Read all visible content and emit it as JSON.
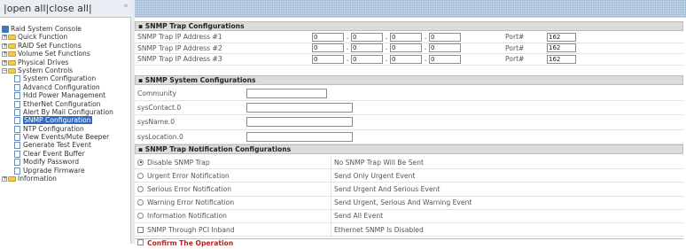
{
  "nav": {
    "open_all": "open all",
    "sep1": "|",
    "close_all": "close all",
    "sep2": "|",
    "root": "Raid System Console",
    "items": [
      {
        "label": "Quick Function",
        "type": "folder",
        "exp": "+"
      },
      {
        "label": "RAID Set Functions",
        "type": "folder",
        "exp": "+"
      },
      {
        "label": "Volume Set Functions",
        "type": "folder",
        "exp": "+"
      },
      {
        "label": "Physical Drives",
        "type": "folder",
        "exp": "+"
      },
      {
        "label": "System Controls",
        "type": "folder",
        "exp": "−"
      },
      {
        "label": "System Configuration",
        "type": "page"
      },
      {
        "label": "Advancd Configuration",
        "type": "page"
      },
      {
        "label": "Hdd Power Management",
        "type": "page"
      },
      {
        "label": "EtherNet Configuration",
        "type": "page"
      },
      {
        "label": "Alert By Mail Configuration",
        "type": "page"
      },
      {
        "label": "SNMP Configuration",
        "type": "page",
        "selected": true
      },
      {
        "label": "NTP Configuration",
        "type": "page"
      },
      {
        "label": "View Events/Mute Beeper",
        "type": "page"
      },
      {
        "label": "Generate Test Event",
        "type": "page"
      },
      {
        "label": "Clear Event Buffer",
        "type": "page"
      },
      {
        "label": "Modify Password",
        "type": "page"
      },
      {
        "label": "Upgrade Firmware",
        "type": "page"
      },
      {
        "label": "Information",
        "type": "folder",
        "exp": "+"
      }
    ]
  },
  "trap": {
    "header": "SNMP Trap Configurations",
    "rows": [
      {
        "label": "SNMP Trap IP Address #1",
        "ip": [
          "0",
          "0",
          "0",
          "0"
        ],
        "port_label": "Port#",
        "port": "162"
      },
      {
        "label": "SNMP Trap IP Address #2",
        "ip": [
          "0",
          "0",
          "0",
          "0"
        ],
        "port_label": "Port#",
        "port": "162"
      },
      {
        "label": "SNMP Trap IP Address #3",
        "ip": [
          "0",
          "0",
          "0",
          "0"
        ],
        "port_label": "Port#",
        "port": "162"
      }
    ]
  },
  "system": {
    "header": "SNMP System Configurations",
    "rows": [
      {
        "label": "Community",
        "value": ""
      },
      {
        "label": "sysContact.0",
        "value": ""
      },
      {
        "label": "sysName.0",
        "value": ""
      },
      {
        "label": "sysLocation.0",
        "value": ""
      }
    ]
  },
  "notify": {
    "header": "SNMP Trap Notification Configurations",
    "rows": [
      {
        "label": "Disable SNMP Trap",
        "desc": "No SNMP Trap Will Be Sent",
        "control": "radio",
        "checked": true
      },
      {
        "label": "Urgent Error Notification",
        "desc": "Send Only Urgent Event",
        "control": "radio",
        "checked": false
      },
      {
        "label": "Serious Error Notification",
        "desc": "Send Urgent And Serious Event",
        "control": "radio",
        "checked": false
      },
      {
        "label": "Warning Error Notification",
        "desc": "Send Urgent, Serious And Warning Event",
        "control": "radio",
        "checked": false
      },
      {
        "label": "Information Notification",
        "desc": "Send All Event",
        "control": "radio",
        "checked": false
      },
      {
        "label": "SNMP Through PCI Inband",
        "desc": "Ethernet SNMP Is Disabled",
        "control": "checkbox",
        "checked": false
      }
    ]
  },
  "confirm_label": "Confirm The Operation",
  "colors": {
    "top_bar": "#9eb8d4",
    "selected": "#316ac5",
    "section": "#dcdcdc",
    "confirm_text": "#b22222"
  }
}
